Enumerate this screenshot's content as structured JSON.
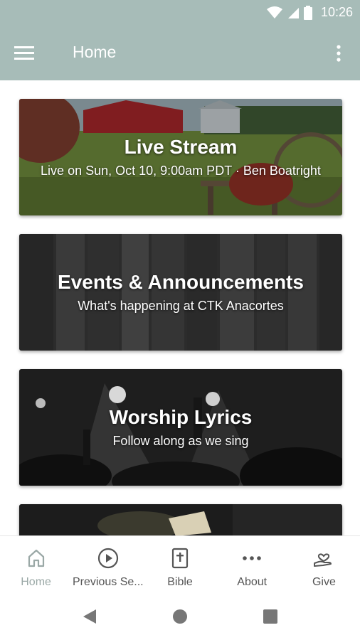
{
  "status_bar": {
    "time": "10:26"
  },
  "app_bar": {
    "title": "Home"
  },
  "cards": [
    {
      "title": "Live Stream",
      "subtitle": "Live on Sun, Oct 10, 9:00am PDT · Ben Boatright"
    },
    {
      "title": "Events & Announcements",
      "subtitle": "What's happening at CTK Anacortes"
    },
    {
      "title": "Worship Lyrics",
      "subtitle": "Follow along as we sing"
    },
    {
      "title": "",
      "subtitle": ""
    }
  ],
  "bottom_nav": {
    "items": [
      {
        "label": "Home",
        "icon": "home-icon",
        "active": true
      },
      {
        "label": "Previous Se...",
        "icon": "play-circle-icon",
        "active": false
      },
      {
        "label": "Bible",
        "icon": "bible-icon",
        "active": false
      },
      {
        "label": "About",
        "icon": "more-horizontal-icon",
        "active": false
      },
      {
        "label": "Give",
        "icon": "heart-hand-icon",
        "active": false
      }
    ]
  },
  "colors": {
    "app_bar": "#a7bcb8",
    "active_nav": "#9aa8a6"
  }
}
